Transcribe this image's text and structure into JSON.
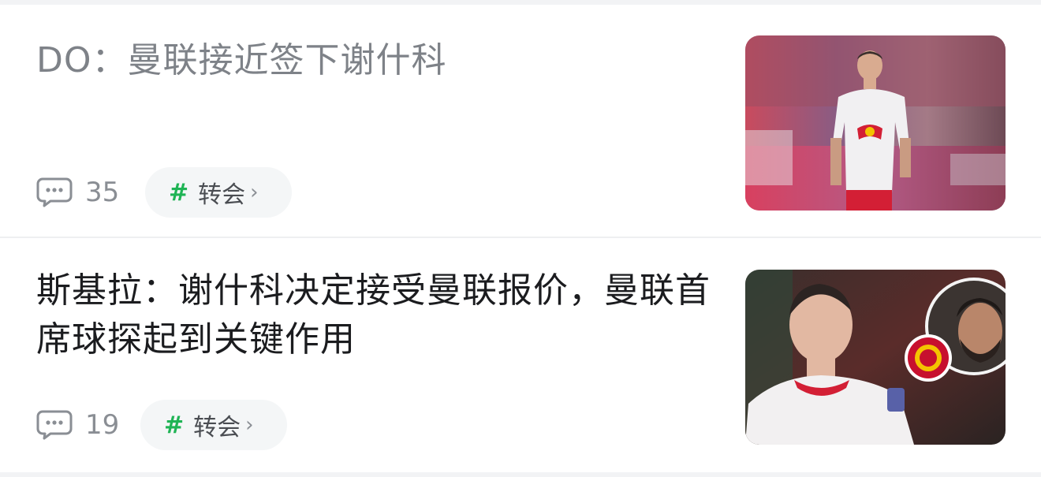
{
  "articles": [
    {
      "title": "DO：曼联接近签下谢什科",
      "comment_count": "35",
      "tag": {
        "hash": "#",
        "label": "转会",
        "chevron": "›"
      },
      "thumbnail_icon": "photo-thumbnail"
    },
    {
      "title": "斯基拉：谢什科决定接受曼联报价，曼联首席球探起到关键作用",
      "comment_count": "19",
      "tag": {
        "hash": "#",
        "label": "转会",
        "chevron": "›"
      },
      "thumbnail_icon": "photo-thumbnail"
    }
  ],
  "colors": {
    "read_title": "#7e8288",
    "unread_title": "#1b1c1f",
    "tag_hash": "#1fb455",
    "chip_bg": "#f4f6f7"
  },
  "icons": {
    "comment": "comment-bubble-icon"
  }
}
